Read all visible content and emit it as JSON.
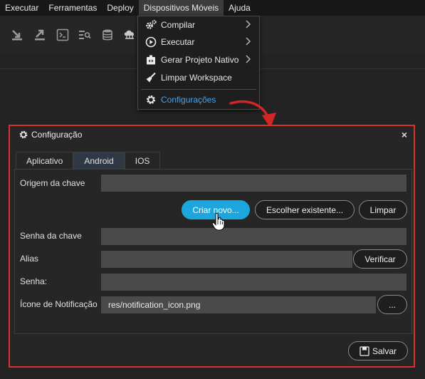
{
  "menubar": {
    "items": [
      "Executar",
      "Ferramentas",
      "Deploy",
      "Dispositivos Móveis",
      "Ajuda"
    ]
  },
  "toolbar": {
    "icons": [
      "import-icon",
      "export-icon",
      "terminal-icon",
      "search-list-icon",
      "database-icon",
      "cloud-network-icon"
    ]
  },
  "dropdown": {
    "items": [
      {
        "label": "Compilar",
        "icon": "cogs-icon",
        "submenu": true
      },
      {
        "label": "Executar",
        "icon": "play-icon",
        "submenu": true
      },
      {
        "label": "Gerar Projeto Nativo",
        "icon": "package-icon",
        "submenu": true
      },
      {
        "label": "Limpar Workspace",
        "icon": "broom-icon",
        "submenu": false
      },
      {
        "label": "Configurações",
        "icon": "gear-icon",
        "submenu": false
      }
    ]
  },
  "dialog": {
    "title": "Configuração",
    "close": "×",
    "tabs": [
      "Aplicativo",
      "Android",
      "IOS"
    ],
    "active_tab": "Android",
    "fields": {
      "origem_label": "Origem da chave",
      "origem_value": "",
      "senha_chave_label": "Senha da chave",
      "senha_chave_value": "",
      "alias_label": "Alias",
      "alias_value": "",
      "senha_label": "Senha:",
      "senha_value": "",
      "icone_label": "Ícone de Notificação",
      "icone_value": "res/notification_icon.png"
    },
    "buttons": {
      "criar_novo": "Criar novo...",
      "escolher": "Escolher existente...",
      "limpar": "Limpar",
      "verificar": "Verificar",
      "browse": "...",
      "salvar": "Salvar"
    }
  },
  "colors": {
    "accent": "#1ba7de",
    "highlight_border": "#d93030",
    "link": "#4aa3e8"
  }
}
